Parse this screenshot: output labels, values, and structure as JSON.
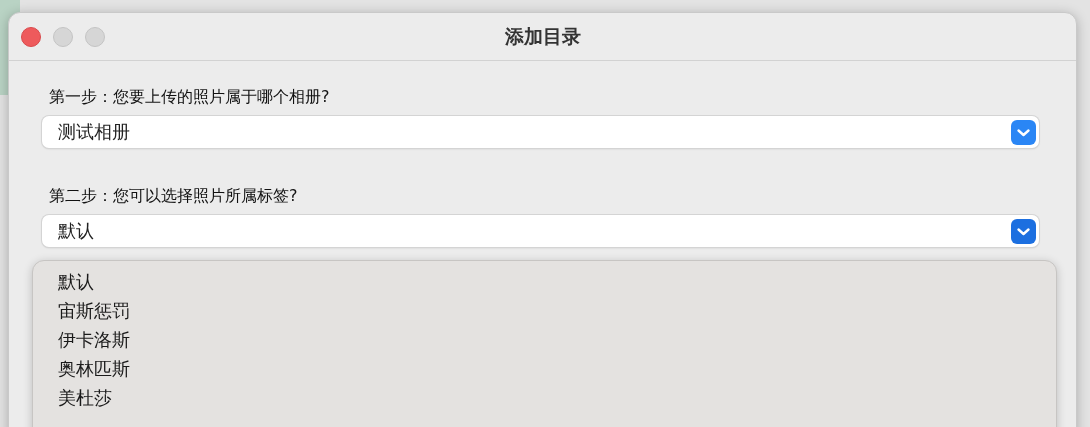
{
  "window": {
    "title": "添加目录"
  },
  "steps": [
    {
      "label": "第一步：您要上传的照片属于哪个相册?",
      "value": "测试相册",
      "open": false
    },
    {
      "label": "第二步：您可以选择照片所属标签?",
      "value": "默认",
      "open": true
    }
  ],
  "menu": {
    "items": [
      {
        "label": "默认"
      },
      {
        "label": "宙斯惩罚"
      },
      {
        "label": "伊卡洛斯"
      },
      {
        "label": "奥林匹斯"
      },
      {
        "label": "美杜莎"
      }
    ]
  }
}
